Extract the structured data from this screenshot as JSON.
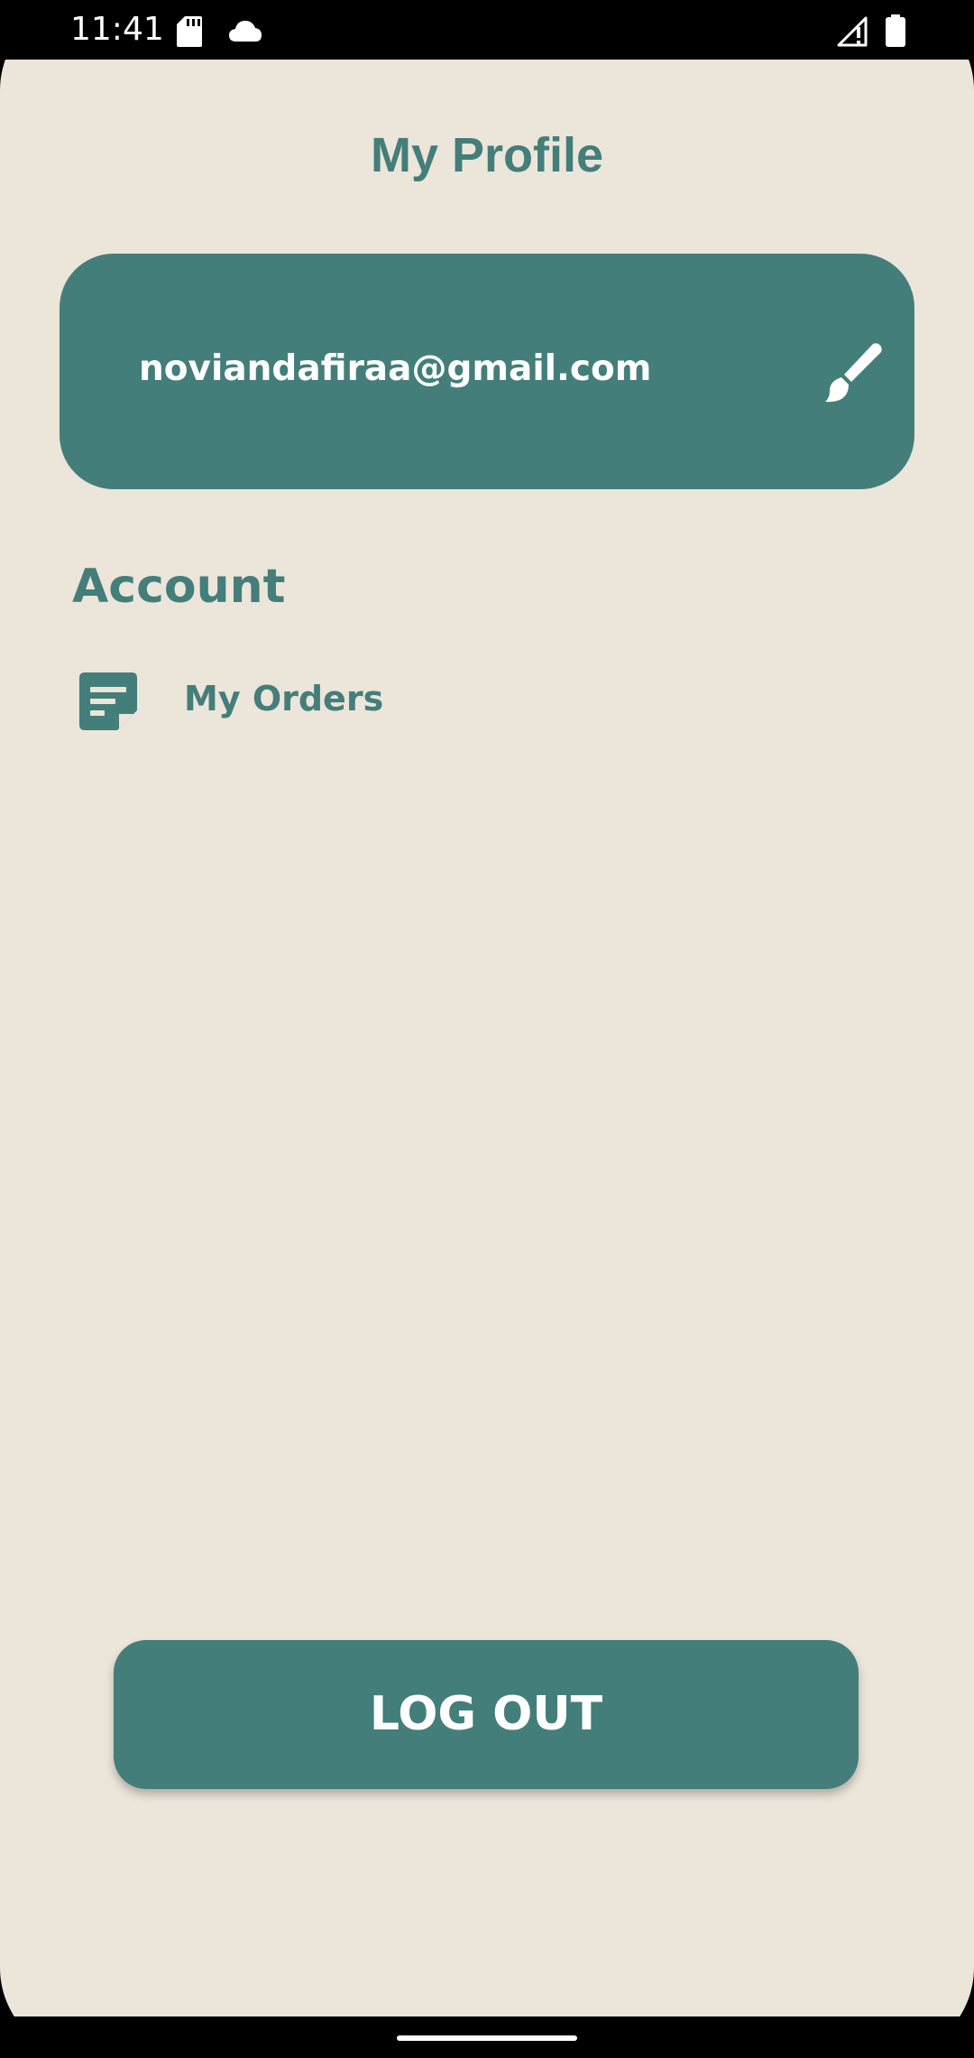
{
  "status_bar": {
    "time": "11:41",
    "left_icons": [
      "sd-card-icon",
      "cloud-icon"
    ],
    "right_icons": [
      "signal-alert-icon",
      "battery-icon"
    ]
  },
  "header": {
    "title": "My Profile"
  },
  "profile_card": {
    "email": "noviandafiraa@gmail.com",
    "edit_icon": "paintbrush-icon"
  },
  "account": {
    "heading": "Account",
    "items": [
      {
        "label": "My Orders",
        "icon": "orders-note-icon"
      }
    ]
  },
  "logout": {
    "label": "LOG OUT"
  },
  "colors": {
    "primary": "#437e7a",
    "background": "#ece5da",
    "on_primary": "#ffffff"
  }
}
